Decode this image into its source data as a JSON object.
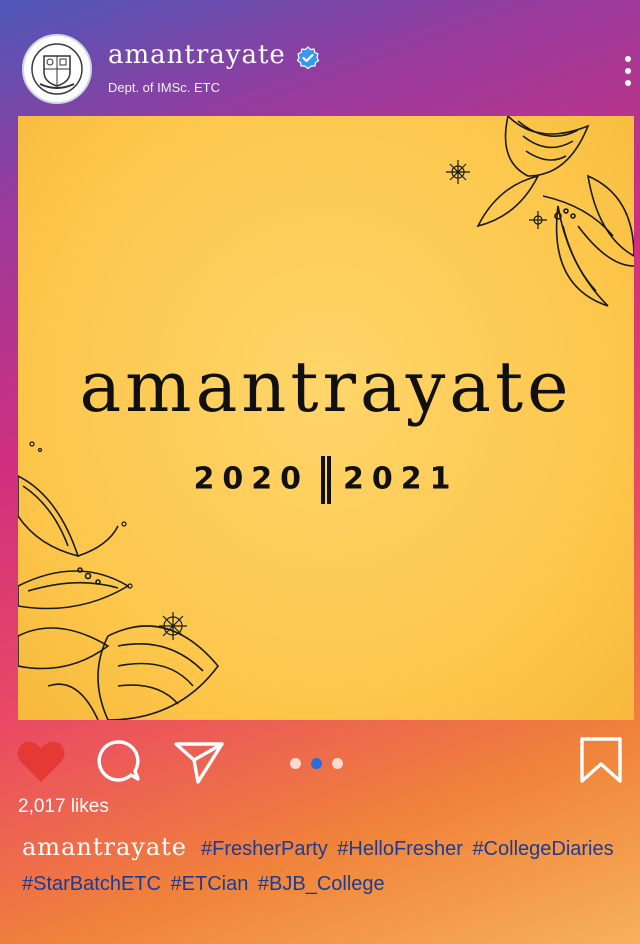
{
  "header": {
    "username": "amantrayate",
    "subtitle": "Dept. of IMSc. ETC",
    "verified": true,
    "avatar_icon": "college-emblem-icon"
  },
  "post": {
    "title": "amantrayate",
    "year_left": "2020",
    "year_right": "2021",
    "background": "#fcc64a",
    "decor_icon": "lily-flower-icon"
  },
  "actions": {
    "liked": true,
    "like_color": "#e53935",
    "carousel": {
      "count": 3,
      "active_index": 1
    }
  },
  "likes_text": "2,017 likes",
  "caption": {
    "username": "amantrayate",
    "tags": [
      "#FresherParty",
      "#HelloFresher",
      "#CollegeDiaries",
      "#StarBatchETC",
      "#ETCian",
      "#BJB_College"
    ]
  }
}
